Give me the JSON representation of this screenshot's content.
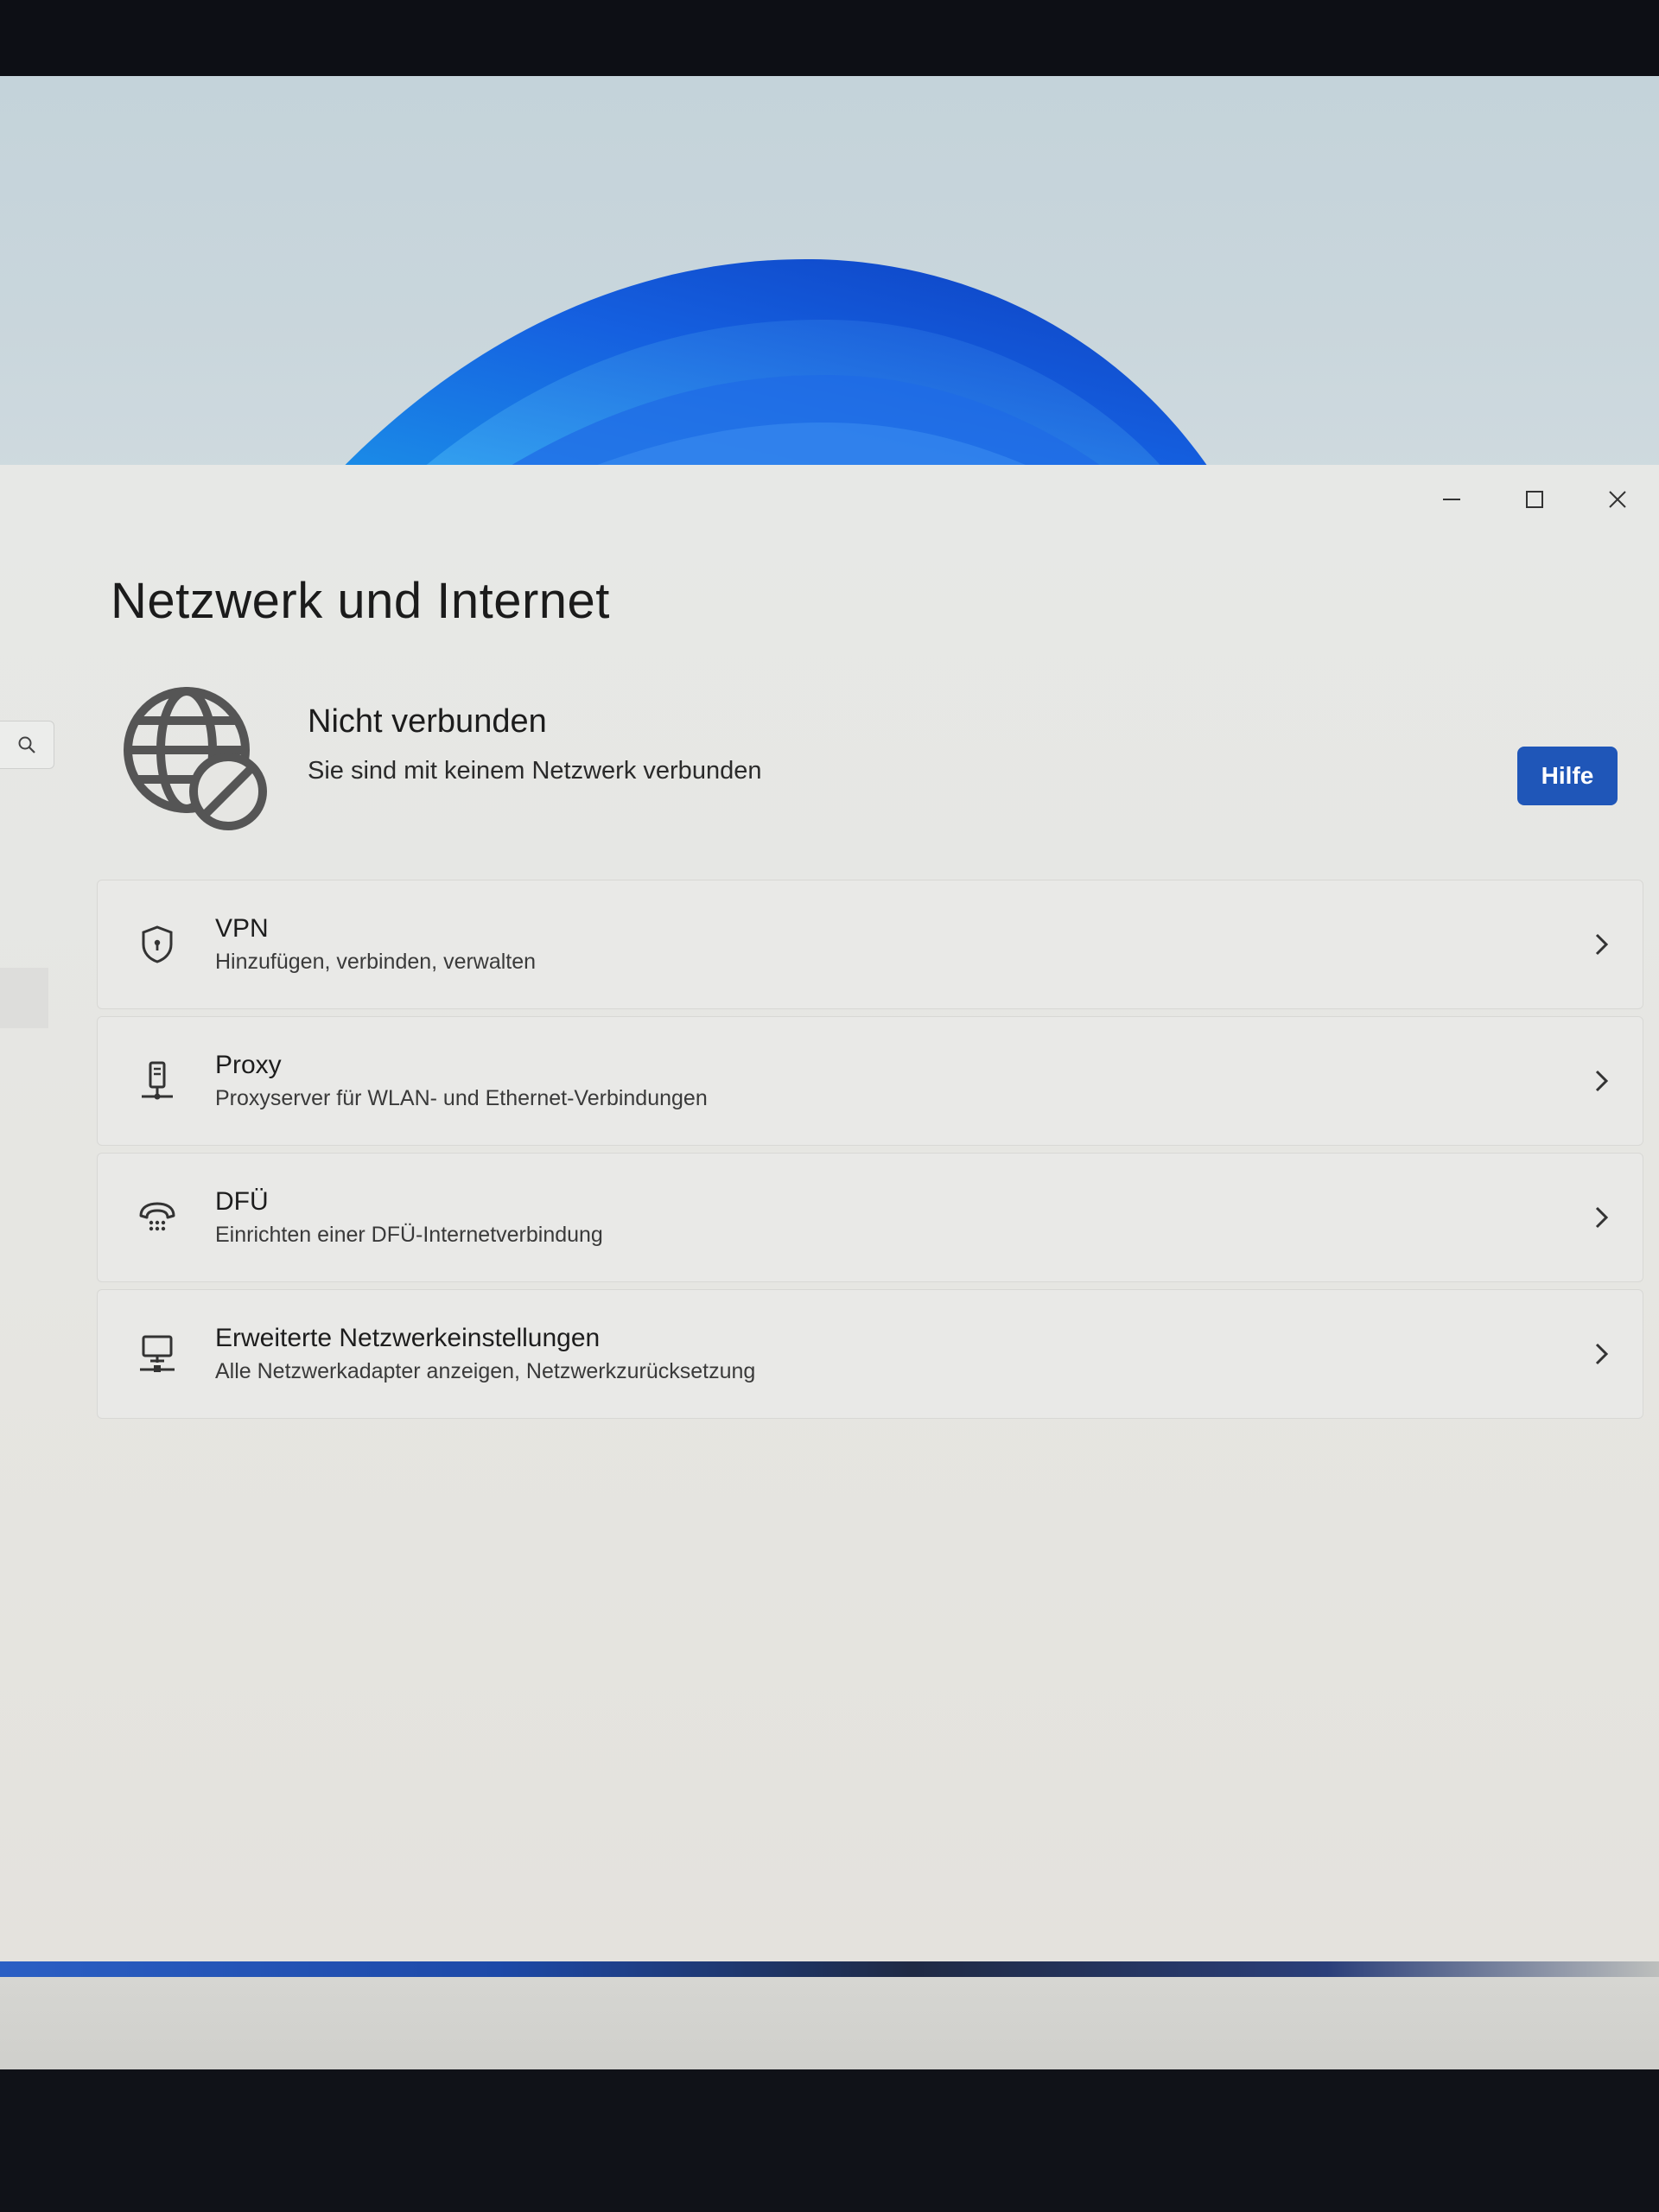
{
  "window": {
    "controls": {
      "minimize": "minimize-icon",
      "maximize": "maximize-icon",
      "close": "close-icon"
    }
  },
  "page": {
    "title": "Netzwerk und Internet"
  },
  "status": {
    "icon": "globe-disconnected-icon",
    "title": "Nicht verbunden",
    "subtitle": "Sie sind mit keinem Netzwerk verbunden",
    "help_label": "Hilfe"
  },
  "items": [
    {
      "icon": "shield-icon",
      "title": "VPN",
      "description": "Hinzufügen, verbinden, verwalten"
    },
    {
      "icon": "proxy-icon",
      "title": "Proxy",
      "description": "Proxyserver für WLAN- und Ethernet-Verbindungen"
    },
    {
      "icon": "dial-up-icon",
      "title": "DFÜ",
      "description": "Einrichten einer DFÜ-Internetverbindung"
    },
    {
      "icon": "network-adapter-icon",
      "title": "Erweiterte Netzwerkeinstellungen",
      "description": "Alle Netzwerkadapter anzeigen, Netzwerkzurücksetzung"
    }
  ],
  "colors": {
    "accent": "#1f56b8",
    "window_bg": "#e6e6e3",
    "card_bg": "#e9e9e7"
  }
}
